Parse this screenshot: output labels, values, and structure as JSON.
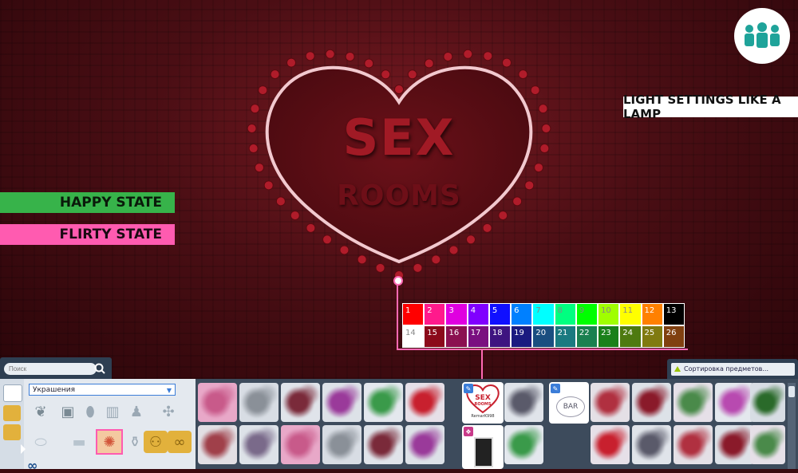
{
  "scene": {
    "sign_title": "SEX",
    "sign_subtitle": "ROOMS"
  },
  "labels": {
    "happy": "HAPPY STATE",
    "flirty": "FLIRTY STATE",
    "light": "LIGHT SETTINGS LIKE A LAMP"
  },
  "swatches": [
    {
      "num": "1",
      "color": "#ff0000"
    },
    {
      "num": "2",
      "color": "#ff1a8c"
    },
    {
      "num": "3",
      "color": "#e000e0"
    },
    {
      "num": "4",
      "color": "#8000ff"
    },
    {
      "num": "5",
      "color": "#1010ff"
    },
    {
      "num": "6",
      "color": "#0080ff"
    },
    {
      "num": "7",
      "color": "#00ffff"
    },
    {
      "num": "8",
      "color": "#00ff80"
    },
    {
      "num": "9",
      "color": "#00ff00"
    },
    {
      "num": "10",
      "color": "#a0ff00"
    },
    {
      "num": "11",
      "color": "#ffff00"
    },
    {
      "num": "12",
      "color": "#ff8000"
    },
    {
      "num": "13",
      "color": "#000000"
    },
    {
      "num": "14",
      "color": "#ffffff"
    },
    {
      "num": "15",
      "color": "#8b0a1a"
    },
    {
      "num": "16",
      "color": "#8b1050"
    },
    {
      "num": "17",
      "color": "#7a1080"
    },
    {
      "num": "18",
      "color": "#3e1480"
    },
    {
      "num": "19",
      "color": "#1a1a80"
    },
    {
      "num": "20",
      "color": "#1a4e80"
    },
    {
      "num": "21",
      "color": "#1a7a80"
    },
    {
      "num": "22",
      "color": "#1a8050"
    },
    {
      "num": "23",
      "color": "#1a801a"
    },
    {
      "num": "24",
      "color": "#4e7a10"
    },
    {
      "num": "25",
      "color": "#807a10"
    },
    {
      "num": "26",
      "color": "#804010"
    }
  ],
  "ui": {
    "search_placeholder": "Поиск",
    "category_dropdown": "Украшения",
    "sort_label": "Сортировка предметов...",
    "highlight_title": "SEX",
    "highlight_subtitle": "ROOMS",
    "highlight_caption": "RemarK998",
    "bar_text": "BAR"
  },
  "colors": {
    "accent_pink": "#ff69b4",
    "happy_green": "#37b34a",
    "flirty_pink": "#ff5bb0"
  }
}
